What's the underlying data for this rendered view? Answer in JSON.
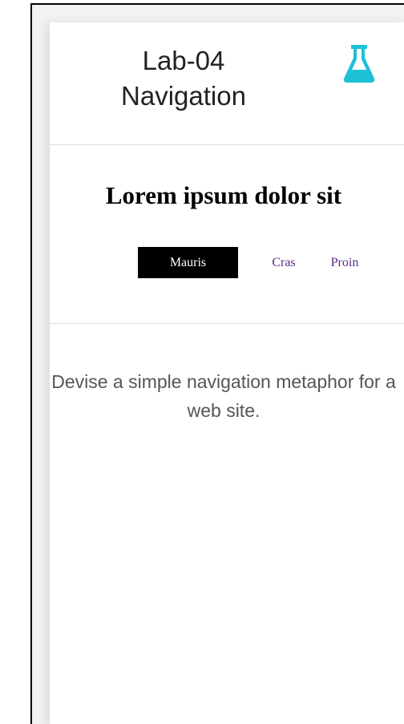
{
  "header": {
    "title": "Lab-04 Navigation",
    "icon": "flask-icon",
    "icon_color": "#1ec0d6"
  },
  "main": {
    "heading": "Lorem ipsum dolor sit",
    "nav": {
      "items": [
        {
          "label": "Mauris",
          "active": true
        },
        {
          "label": "Cras",
          "active": false
        },
        {
          "label": "Proin",
          "active": false
        }
      ],
      "active_bg": "#000000",
      "link_color": "#5b2a86"
    },
    "description": "Devise a simple navigation metaphor for a web site."
  }
}
